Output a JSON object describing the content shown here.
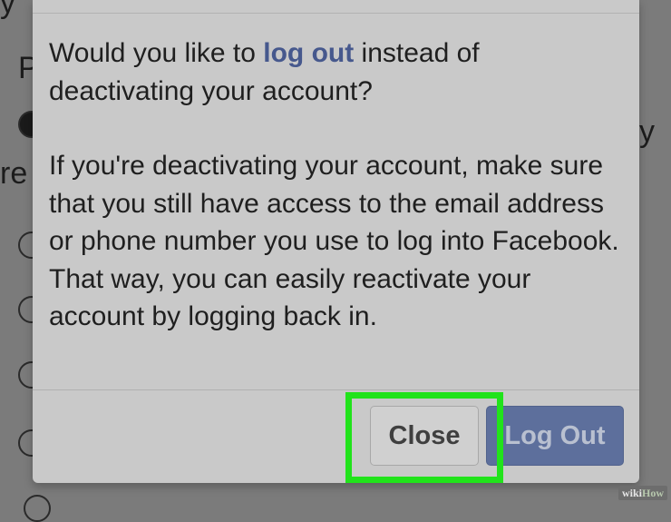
{
  "background": {
    "partial_letters": [
      "y",
      "P",
      "y",
      "re"
    ]
  },
  "dialog": {
    "question_prefix": "Would you like to ",
    "question_link": "log out",
    "question_suffix": " instead of deactivating your account?",
    "info": "If you're deactivating your account, make sure that you still have access to the email address or phone number you use to log into Facebook. That way, you can easily reactivate your account by logging back in.",
    "close_label": "Close",
    "logout_label": "Log Out"
  },
  "watermark": {
    "part1": "wiki",
    "part2": "How"
  },
  "colors": {
    "link": "#46588d",
    "primary_button": "#5d6f9c",
    "highlight": "#21e31b"
  }
}
